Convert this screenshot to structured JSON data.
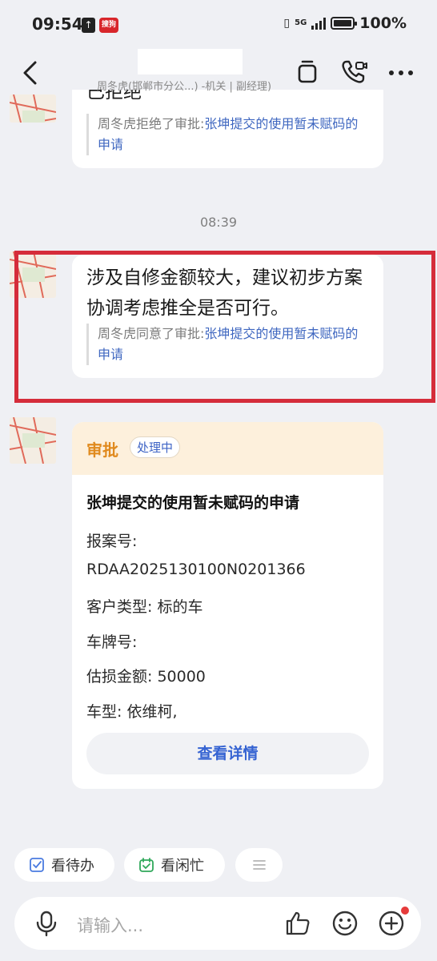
{
  "status_bar": {
    "time": "09:54",
    "app_badge_label": "搜狗",
    "network": "5G",
    "battery": "100%"
  },
  "header": {
    "subtitle": "周冬虎(邯郸市分公...) -机关 | 副经理)"
  },
  "messages": [
    {
      "partial_text": "已拒绝",
      "quote_prefix": "周冬虎拒绝了审批:",
      "quote_link": "张坤提交的使用暂未赋码的申请"
    },
    {
      "text": "涉及自修金额较大，建议初步方案协调考虑推全是否可行。",
      "quote_prefix": "周冬虎同意了审批:",
      "quote_link": "张坤提交的使用暂未赋码的申请"
    }
  ],
  "timestamp": "08:39",
  "approval_card": {
    "tag": "审批",
    "status": "处理中",
    "title": "张坤提交的使用暂未赋码的申请",
    "fields": [
      "报案号:",
      "RDAA2025130100N0201366",
      "客户类型: 标的车",
      "车牌号:",
      "估损金额: 50000",
      "车型: 依维柯,"
    ],
    "button": "查看详情"
  },
  "quick_actions": [
    {
      "label": "看待办",
      "icon": "todo-check-icon"
    },
    {
      "label": "看闲忙",
      "icon": "calendar-check-icon"
    },
    {
      "label": "",
      "icon": "menu-lines-icon"
    }
  ],
  "input": {
    "placeholder": "请输入..."
  },
  "colors": {
    "highlight_border": "#d52c3a",
    "link": "#3f67c0",
    "card_header": "#fdf0dc",
    "card_tag": "#e08a1e",
    "button_text": "#3563d2"
  }
}
